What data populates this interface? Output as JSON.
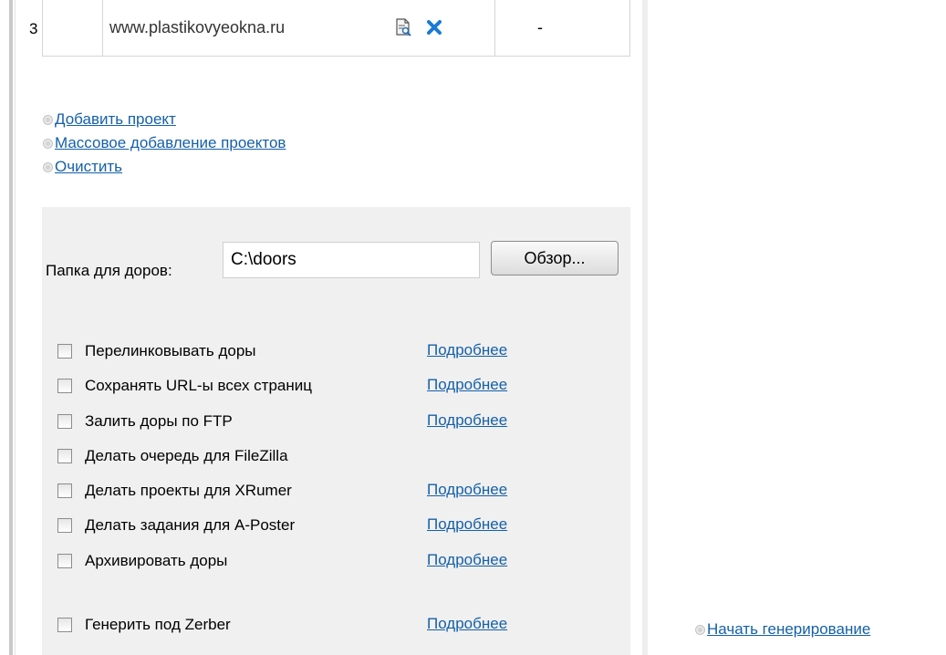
{
  "table": {
    "row": {
      "number": "3",
      "url": "www.plastikovyeokna.ru",
      "status": "-"
    },
    "icons": {
      "preview": "document-preview-icon",
      "delete": "close-icon"
    }
  },
  "links": [
    "Добавить проект",
    "Массовое добавление проектов",
    "Очистить"
  ],
  "folder": {
    "label": "Папка для доров:",
    "value": "C:\\doors",
    "browse_label": "Обзор..."
  },
  "options": [
    {
      "label": "Перелинковывать доры",
      "more": "Подробнее",
      "checked": false
    },
    {
      "label": "Сохранять URL-ы всех страниц",
      "more": "Подробнее",
      "checked": false
    },
    {
      "label": "Залить доры по FTP",
      "more": "Подробнее",
      "checked": false
    },
    {
      "label": "Делать очередь для FileZilla",
      "more": "",
      "checked": false
    },
    {
      "label": "Делать проекты для XRumer",
      "more": "Подробнее",
      "checked": false
    },
    {
      "label": "Делать задания для A-Poster",
      "more": "Подробнее",
      "checked": false
    },
    {
      "label": "Архивировать доры",
      "more": "Подробнее",
      "checked": false
    },
    {
      "label": "Генерить под Zerber",
      "more": "Подробнее",
      "checked": false
    }
  ],
  "start_label": "Начать генерирование",
  "colors": {
    "link": "#1560a8",
    "panel_bg": "#f0f0f0",
    "delete_icon": "#1a7ad4"
  }
}
